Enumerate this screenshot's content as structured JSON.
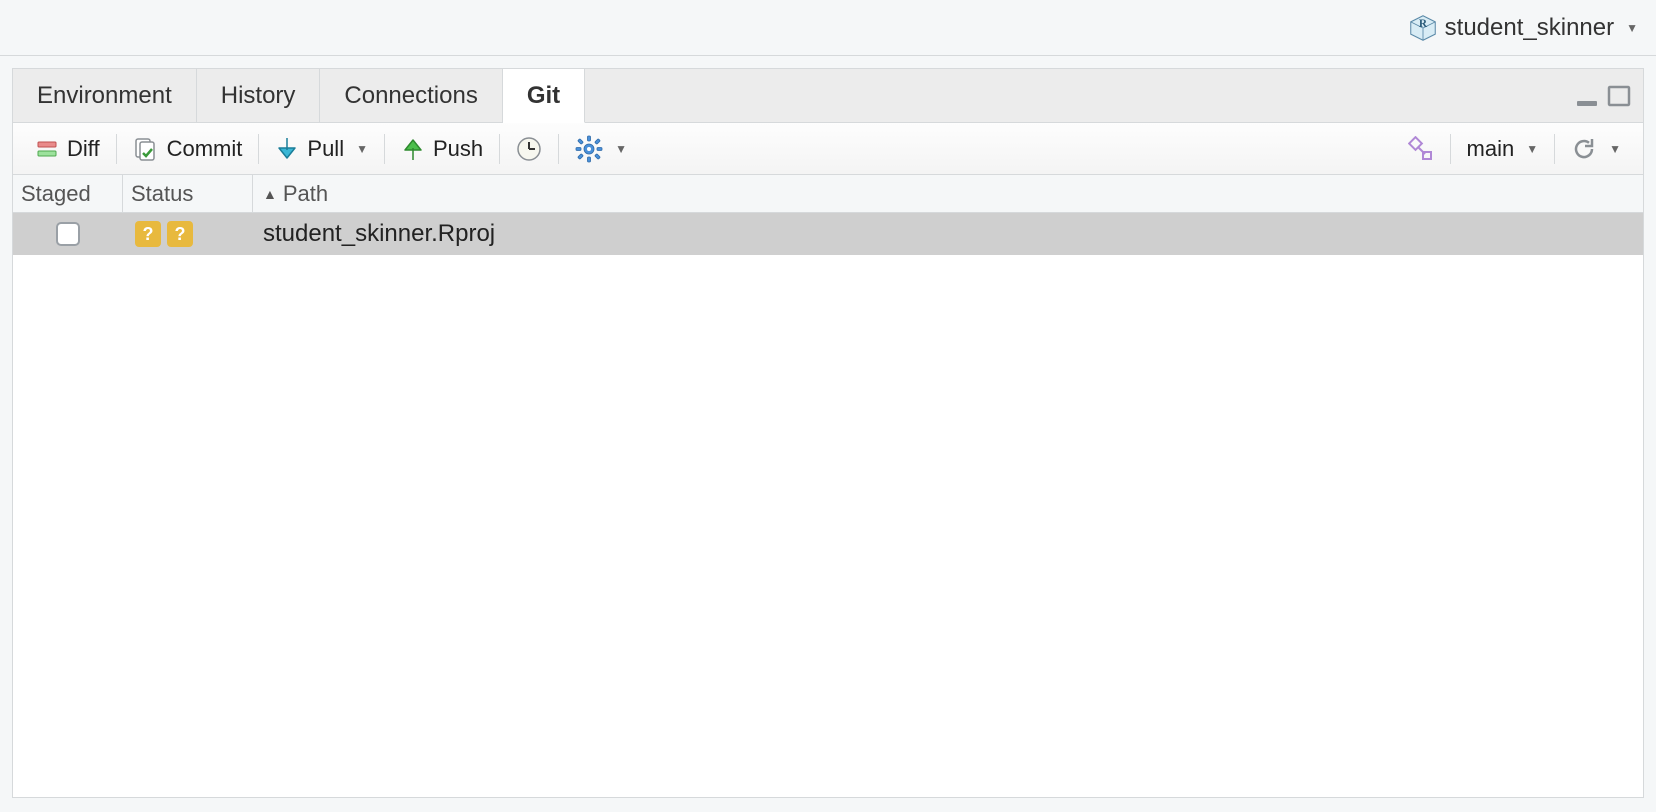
{
  "project": {
    "name": "student_skinner"
  },
  "tabs": [
    {
      "label": "Environment"
    },
    {
      "label": "History"
    },
    {
      "label": "Connections"
    },
    {
      "label": "Git"
    }
  ],
  "toolbar": {
    "diff": "Diff",
    "commit": "Commit",
    "pull": "Pull",
    "push": "Push",
    "branch": "main"
  },
  "columns": {
    "staged": "Staged",
    "status": "Status",
    "path": "Path"
  },
  "files": [
    {
      "staged": false,
      "status_left": "?",
      "status_right": "?",
      "path": "student_skinner.Rproj"
    }
  ]
}
